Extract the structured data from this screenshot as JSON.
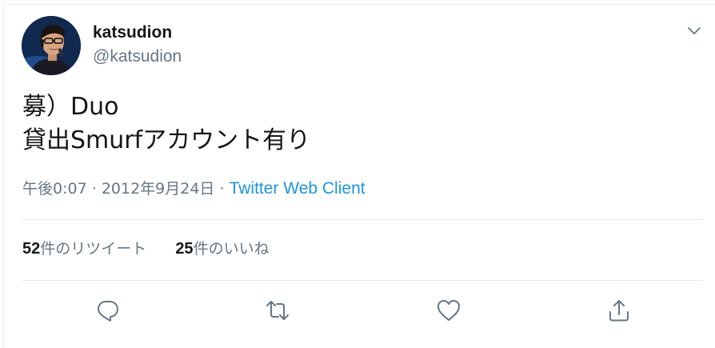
{
  "user": {
    "display_name": "katsudion",
    "screen_name": "@katsudion"
  },
  "tweet": {
    "text": "募）Duo\n貸出Smurfアカウント有り",
    "time": "午後0:07",
    "separator": "·",
    "date": "2012年9月24日",
    "client": "Twitter Web Client"
  },
  "stats": {
    "retweets": {
      "count": "52",
      "label": "件のリツイート"
    },
    "likes": {
      "count": "25",
      "label": "件のいいね"
    }
  },
  "icons": {
    "caret": "chevron-down-icon",
    "reply": "reply-icon",
    "retweet": "retweet-icon",
    "like": "heart-icon",
    "share": "share-icon"
  },
  "colors": {
    "text": "#14171a",
    "secondary": "#657786",
    "link": "#1b95e0",
    "divider": "#e6ecf0"
  }
}
